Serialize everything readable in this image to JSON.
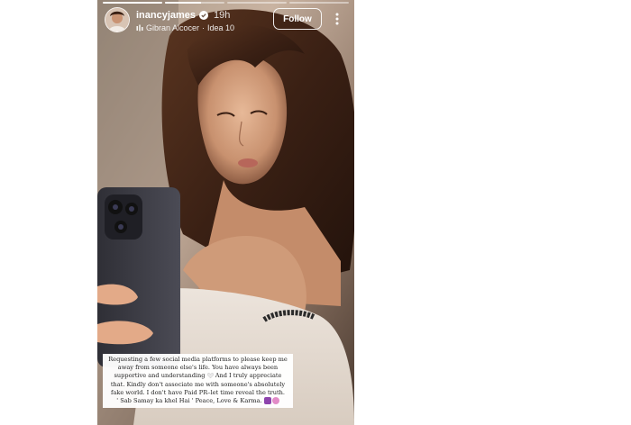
{
  "story": {
    "progress": [
      1,
      0.6,
      0,
      0
    ],
    "username": "inancyjames",
    "verified": true,
    "time_ago": "19h",
    "music_artist": "Gibran Alcocer",
    "music_track": "Idea 10",
    "music_separator": "·",
    "follow_label": "Follow",
    "more_icon": "more-vertical-icon",
    "photo_description_icon": "selfie-photo",
    "caption_lines": [
      "Requesting a few social media platforms to please keep me",
      "away from someone else's life. You have always been",
      "supportive and understanding",
      "And I truly appreciate",
      "that. Kindly don't associate me with someone's absolutely",
      "fake world. I don't have Paid PR–let time reveal the truth.",
      "' Sab Samay ka khel Hai ' Peace, Love & Karma."
    ]
  },
  "colors": {
    "accent_white": "#ffffff",
    "verified_blue": "#ffffff",
    "caption_bg": "#f7f5f3"
  }
}
